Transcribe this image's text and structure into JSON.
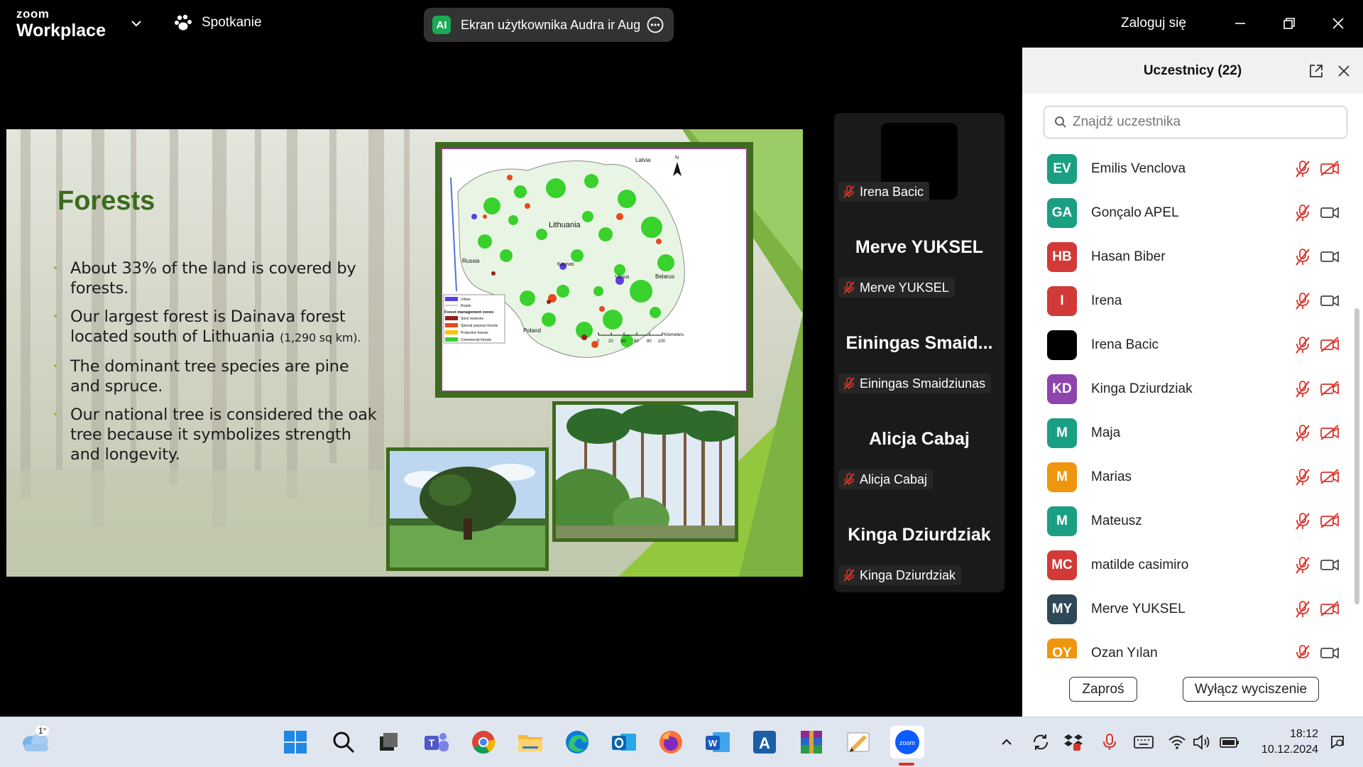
{
  "titlebar": {
    "brand_small": "zoom",
    "brand_large": "Workplace",
    "meeting_label": "Spotkanie",
    "share_badge": "AI",
    "share_label": "Ekran użytkownika Audra ir Augu",
    "login_label": "Zaloguj się"
  },
  "slide": {
    "title": "Forests",
    "bullets": [
      {
        "text": "About 33% of the land is covered by forests.",
        "small": ""
      },
      {
        "text": "Our largest forest is Dainava forest located south of Lithuania ",
        "small": "(1,290 sq km)."
      },
      {
        "text": "The dominant tree species are pine and spruce.",
        "small": ""
      },
      {
        "text": "Our national tree is considered the oak tree because it symbolizes strength and longevity.",
        "small": ""
      }
    ],
    "map": {
      "labels": {
        "latvia": "Latvia",
        "lithuania": "Lithuania",
        "russia": "Russia",
        "belarus": "Belarus",
        "poland": "Poland",
        "kaunas": "Kaunas",
        "vilnius": "Vilnius",
        "north": "N"
      },
      "legend": {
        "urban": "Urban",
        "roads": "Roads",
        "zones_title": "Forest management zones",
        "strict": "Strict reserves",
        "special": "Special purpose forests",
        "protective": "Protective forests",
        "commercial": "Commercial forests"
      },
      "scale": {
        "ticks": [
          "0",
          "20",
          "40",
          "60",
          "80",
          "100"
        ],
        "unit": "Kilometers"
      }
    }
  },
  "tiles": [
    {
      "big": "",
      "tag": "Irena Bacic",
      "video_off": true
    },
    {
      "big": "Merve YUKSEL",
      "tag": "Merve YUKSEL"
    },
    {
      "big": "Einingas  Smaid...",
      "tag": "Einingas Smaidziunas"
    },
    {
      "big": "Alicja Cabaj",
      "tag": "Alicja Cabaj"
    },
    {
      "big": "Kinga Dziurdziak",
      "tag": "Kinga Dziurdziak"
    }
  ],
  "panel": {
    "title": "Uczestnicy (22)",
    "search_placeholder": "Znajdź uczestnika",
    "participants": [
      {
        "initials": "EV",
        "name": "Emilis Venclova",
        "color": "#1a9f83",
        "video_on": false
      },
      {
        "initials": "GA",
        "name": "Gonçalo APEL",
        "color": "#1a9f83",
        "video_on": true
      },
      {
        "initials": "HB",
        "name": "Hasan Biber",
        "color": "#d13a37",
        "video_on": true
      },
      {
        "initials": "I",
        "name": "Irena",
        "color": "#d13a37",
        "video_on": true
      },
      {
        "initials": "",
        "name": "Irena Bacic",
        "color": "#000000",
        "video_on": false
      },
      {
        "initials": "KD",
        "name": "Kinga Dziurdziak",
        "color": "#8e44ad",
        "video_on": false
      },
      {
        "initials": "M",
        "name": "Maja",
        "color": "#1a9f83",
        "video_on": false
      },
      {
        "initials": "M",
        "name": "Marias",
        "color": "#f0960e",
        "video_on": false
      },
      {
        "initials": "M",
        "name": "Mateusz",
        "color": "#1a9f83",
        "video_on": false
      },
      {
        "initials": "MC",
        "name": "matilde casimiro",
        "color": "#d13a37",
        "video_on": true
      },
      {
        "initials": "MY",
        "name": "Merve YUKSEL",
        "color": "#2f4858",
        "video_on": false
      },
      {
        "initials": "OY",
        "name": "Ozan Yılan",
        "color": "#f0960e",
        "video_on": true
      }
    ],
    "invite_label": "Zaproś",
    "mute_all_label": "Wyłącz wyciszenie"
  },
  "taskbar": {
    "weather_temp": "1°",
    "time": "18:12",
    "date": "10.12.2024",
    "apps": [
      "windows-start-icon",
      "search-icon",
      "task-view-icon",
      "teams-icon",
      "chrome-icon",
      "file-explorer-icon",
      "edge-icon",
      "outlook-icon",
      "firefox-icon",
      "word-icon",
      "autodesk-icon",
      "winrar-icon",
      "pencil-app-icon",
      "zoom-icon"
    ]
  },
  "colors": {
    "slide_title": "#3a6b1c",
    "accent_green": "#8bc34a",
    "mute_red": "#d8342c"
  }
}
